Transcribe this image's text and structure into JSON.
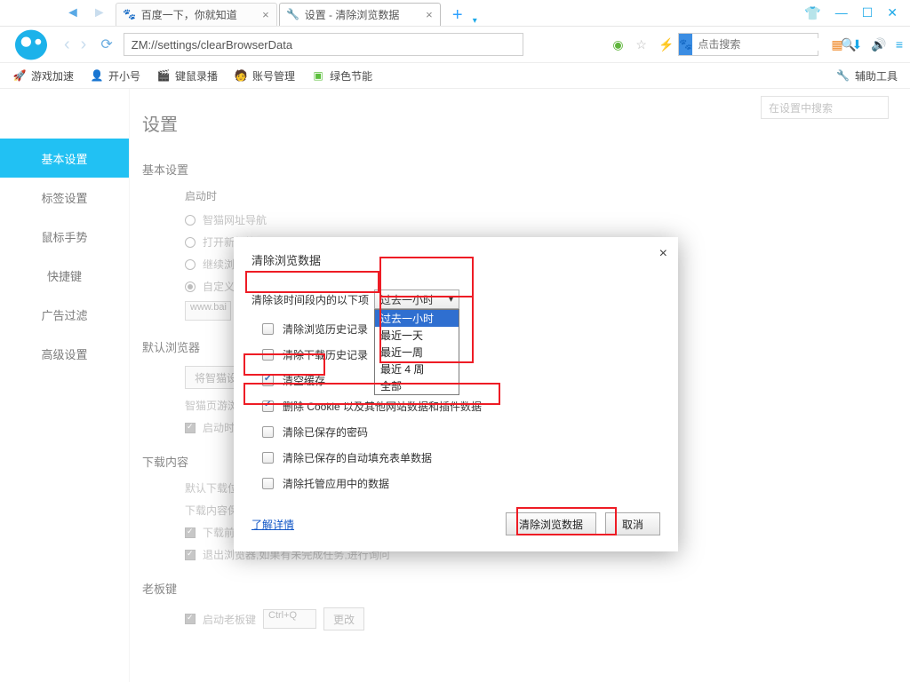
{
  "titlebar": {
    "tabs": [
      {
        "label": "百度一下，你就知道",
        "favicon": "paw"
      },
      {
        "label": "设置 - 清除浏览数据",
        "favicon": "wrench"
      }
    ]
  },
  "addressbar": {
    "url": "ZM://settings/clearBrowserData",
    "search_placeholder": "点击搜索"
  },
  "bookmarks": [
    {
      "label": "游戏加速",
      "icon": "rocket",
      "color": "#f67b2e"
    },
    {
      "label": "开小号",
      "icon": "user",
      "color": "#3aa8e8"
    },
    {
      "label": "键鼠录播",
      "icon": "clapper",
      "color": "#7a6b58"
    },
    {
      "label": "账号管理",
      "icon": "avatar",
      "color": "#f0a13c"
    },
    {
      "label": "绿色节能",
      "icon": "leaf",
      "color": "#5cbf3d"
    }
  ],
  "aux_tools_label": "辅助工具",
  "settings": {
    "page_title": "设置",
    "search_placeholder": "在设置中搜索",
    "side": [
      "基本设置",
      "标签设置",
      "鼠标手势",
      "快捷键",
      "广告过滤",
      "高级设置"
    ],
    "section_basic": "基本设置",
    "startup": {
      "title": "启动时",
      "o1": "智猫网址导航",
      "o2": "打开新标签页",
      "o3": "继续浏览上次关闭时的网页",
      "o4": "自定义",
      "input_hint": "www.bai"
    },
    "default_browser": {
      "title": "默认浏览器",
      "btn": "将智猫设",
      "note": "智猫页游浏览器不是默认浏览器",
      "chk": "启动时检查是否为默认浏览器"
    },
    "download": {
      "title": "下载内容",
      "path_label": "默认下载位置",
      "target_label": "下载内容保存到",
      "ask": "下载前询问每个文件的保存位置",
      "exit": "退出浏览器,如果有未完成任务,进行询问"
    },
    "bosskey": {
      "title": "老板键",
      "chk": "启动老板键",
      "value": "Ctrl+Q",
      "btn": "更改"
    }
  },
  "modal": {
    "title": "清除浏览数据",
    "prompt": "清除该时间段内的以下项",
    "select_value": "过去一小时",
    "options": [
      "过去一小时",
      "最近一天",
      "最近一周",
      "最近 4 周",
      "全部"
    ],
    "items": [
      {
        "label": "清除浏览历史记录",
        "checked": false
      },
      {
        "label": "清除下载历史记录",
        "checked": false
      },
      {
        "label": "清空缓存",
        "checked": true
      },
      {
        "label": "删除 Cookie 以及其他网站数据和插件数据",
        "checked": true
      },
      {
        "label": "清除已保存的密码",
        "checked": false
      },
      {
        "label": "清除已保存的自动填充表单数据",
        "checked": false
      },
      {
        "label": "清除托管应用中的数据",
        "checked": false
      }
    ],
    "learn_more": "了解详情",
    "btn_clear": "清除浏览数据",
    "btn_cancel": "取消"
  }
}
